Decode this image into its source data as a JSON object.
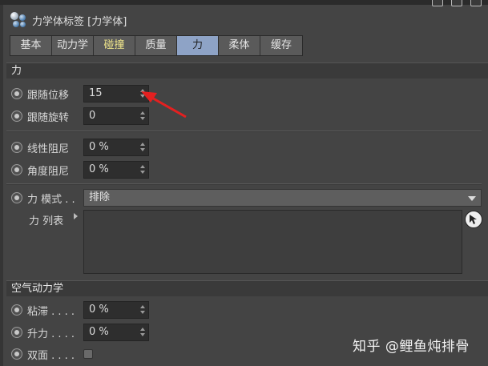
{
  "header": {
    "title": "力学体标签 [力学体]",
    "icon": "rigid-body-molecule-icon"
  },
  "tabs": [
    {
      "label": "基本"
    },
    {
      "label": "动力学"
    },
    {
      "label": "碰撞"
    },
    {
      "label": "质量"
    },
    {
      "label": "力"
    },
    {
      "label": "柔体"
    },
    {
      "label": "缓存"
    }
  ],
  "active_tab": "力",
  "sections": {
    "force": "力",
    "aerodynamics": "空气动力学"
  },
  "fields": {
    "follow_position": {
      "label": "跟随位移",
      "value": "15"
    },
    "follow_rotation": {
      "label": "跟随旋转",
      "value": "0"
    },
    "linear_damping": {
      "label": "线性阻尼",
      "value": "0 %"
    },
    "angular_damping": {
      "label": "角度阻尼",
      "value": "0 %"
    },
    "force_mode": {
      "label": "力 模式 . .",
      "value": "排除"
    },
    "force_list": {
      "label": "力 列表"
    },
    "drag": {
      "label": "粘滞 . . . .",
      "value": "0 %"
    },
    "lift": {
      "label": "升力 . . . .",
      "value": "0 %"
    },
    "two_sided": {
      "label": "双面 . . . .",
      "checked": false
    }
  },
  "watermark": "知乎 @鲤鱼炖排骨",
  "colors": {
    "background": "#444444",
    "active_tab": "#8ea3c6",
    "collision_tab_text": "#f0e68c",
    "annotation_arrow": "#e32020"
  }
}
